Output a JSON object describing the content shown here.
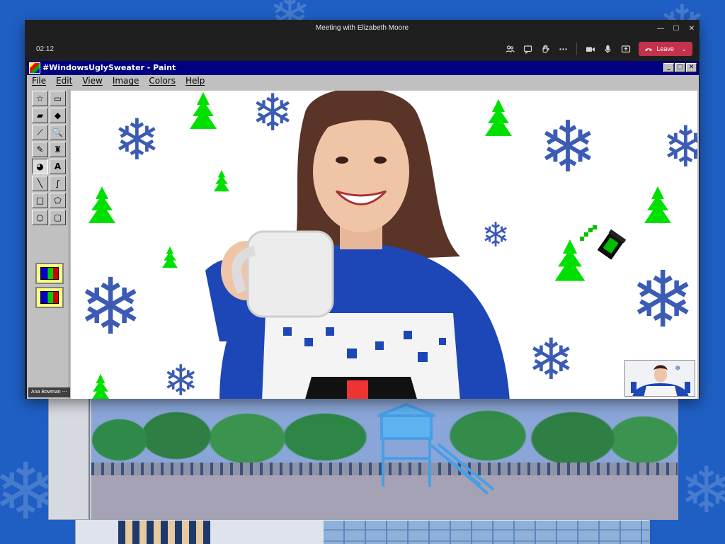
{
  "window": {
    "title": "Meeting with Elizabeth Moore",
    "controls": {
      "minimize": "—",
      "maximize": "☐",
      "close": "✕"
    }
  },
  "meeting": {
    "timer": "02:12",
    "leave_label": "Leave"
  },
  "paint": {
    "title": "#WindowsUglySweater - Paint",
    "menu": [
      "File",
      "Edit",
      "View",
      "Image",
      "Colors",
      "Help"
    ],
    "tools": [
      {
        "name": "free-select-tool",
        "glyph": "☆"
      },
      {
        "name": "select-tool",
        "glyph": "▭"
      },
      {
        "name": "eraser-tool",
        "glyph": "▰"
      },
      {
        "name": "fill-tool",
        "glyph": "◆"
      },
      {
        "name": "pick-color-tool",
        "glyph": "⟋"
      },
      {
        "name": "magnifier-tool",
        "glyph": "🔍"
      },
      {
        "name": "pencil-tool",
        "glyph": "✎"
      },
      {
        "name": "brush-tool",
        "glyph": "♜"
      },
      {
        "name": "airbrush-tool",
        "glyph": "◕"
      },
      {
        "name": "text-tool",
        "glyph": "A"
      },
      {
        "name": "line-tool",
        "glyph": "╲"
      },
      {
        "name": "curve-tool",
        "glyph": "∫"
      },
      {
        "name": "rectangle-tool",
        "glyph": "□"
      },
      {
        "name": "polygon-tool",
        "glyph": "⬠"
      },
      {
        "name": "ellipse-tool",
        "glyph": "○"
      },
      {
        "name": "rounded-rectangle-tool",
        "glyph": "▢"
      }
    ],
    "participant_name": "Ana Bowman"
  },
  "colors": {
    "teams_bg": "#201f1f",
    "leave": "#c4314b",
    "paint_title": "#000080",
    "flake": "#3b5bb5",
    "tree": "#00e000",
    "page_bg": "#1f5fc4"
  }
}
